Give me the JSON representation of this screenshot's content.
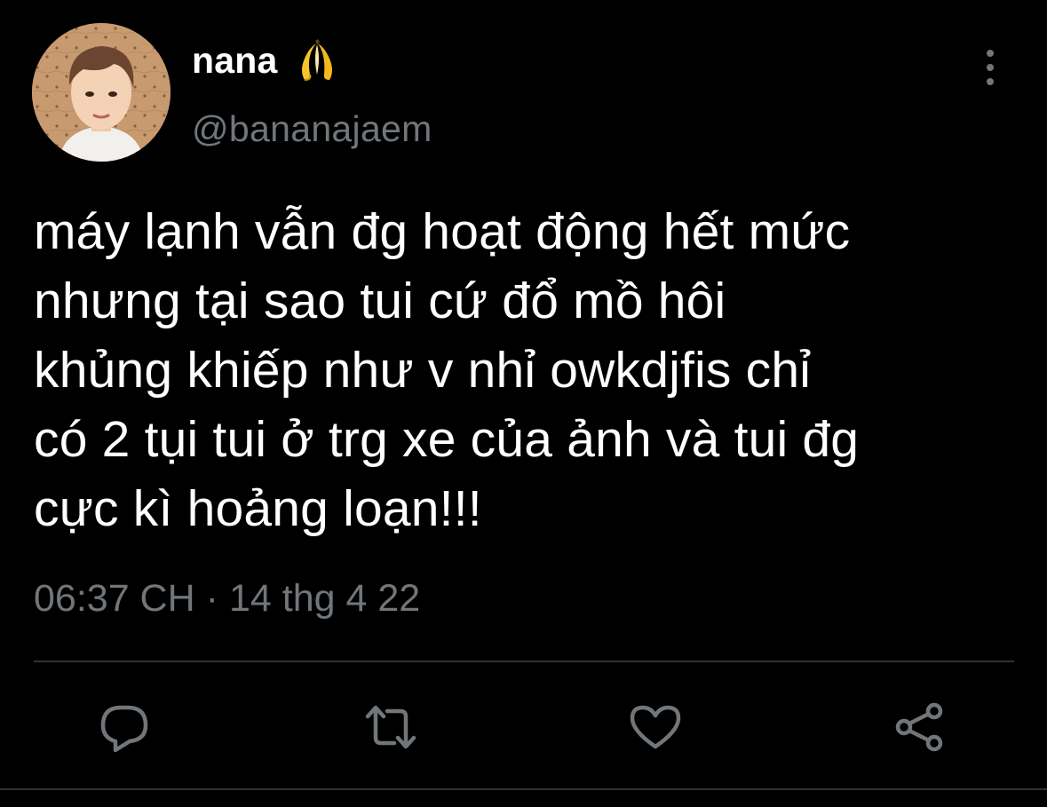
{
  "user": {
    "display_name": "nana",
    "name_emoji": "banana-icon",
    "handle": "@bananajaem"
  },
  "tweet": {
    "text": "máy lạnh vẫn đg hoạt động hết mức\nnhưng tại sao tui cứ đổ mồ hôi\nkhủng khiếp như v nhỉ owkdjfis chỉ\ncó 2 tụi tui ở trg xe của ảnh và tui đg\ncực kì hoảng loạn!!!",
    "time": "06:37 CH",
    "separator": "·",
    "date": "14 thg 4 22"
  },
  "actions": {
    "reply_icon": "reply-icon",
    "retweet_icon": "retweet-icon",
    "like_icon": "heart-icon",
    "share_icon": "share-icon"
  },
  "colors": {
    "background": "#000000",
    "text": "#ffffff",
    "secondary": "#71767b",
    "divider": "#2f3336"
  }
}
